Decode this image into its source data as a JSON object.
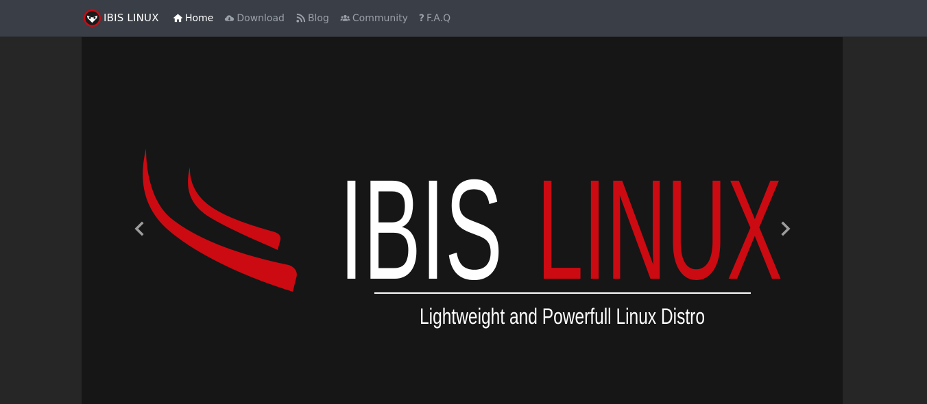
{
  "brand": {
    "name": "IBIS LINUX",
    "logo_icon": "ibis-owl-logo-icon"
  },
  "nav": {
    "items": [
      {
        "label": "Home",
        "icon": "home-icon",
        "active": true
      },
      {
        "label": "Download",
        "icon": "cloud-download-icon",
        "active": false
      },
      {
        "label": "Blog",
        "icon": "rss-icon",
        "active": false
      },
      {
        "label": "Community",
        "icon": "users-icon",
        "active": false
      },
      {
        "label": "F.A.Q",
        "icon": "question-icon",
        "active": false
      }
    ]
  },
  "hero": {
    "title_part1": "IBIS",
    "title_part2": "LINUX",
    "tagline": "Lightweight and Powerfull Linux Distro",
    "logo_icon": "ibis-wings-logo-icon"
  },
  "carousel": {
    "prev_icon": "chevron-left-icon",
    "next_icon": "chevron-right-icon"
  },
  "colors": {
    "navbar_bg": "#3a3e46",
    "slide_bg": "#161616",
    "accent_red": "#cc0a12",
    "white": "#ffffff",
    "nav_inactive": "#9aa0a8"
  }
}
